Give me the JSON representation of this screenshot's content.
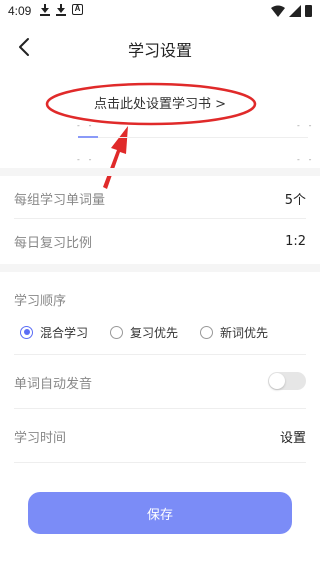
{
  "status_bar": {
    "time": "4:09"
  },
  "header": {
    "title": "学习设置",
    "back_icon": "chevron-left-icon"
  },
  "book": {
    "link_label": "点击此处设置学习书 >",
    "dash_tl": "- -",
    "dash_tr": "- -",
    "dash_bl": "- -",
    "dash_br": "- -"
  },
  "settings": {
    "group_words_label": "每组学习单词量",
    "group_words_value": "5个",
    "review_ratio_label": "每日复习比例",
    "review_ratio_value": "1:2",
    "order_label": "学习顺序",
    "order_options": [
      {
        "label": "混合学习",
        "checked": true
      },
      {
        "label": "复习优先",
        "checked": false
      },
      {
        "label": "新词优先",
        "checked": false
      }
    ],
    "auto_pronounce_label": "单词自动发音",
    "auto_pronounce_on": false,
    "study_time_label": "学习时间",
    "study_time_value": "设置"
  },
  "footer": {
    "save_label": "保存"
  },
  "colors": {
    "accent": "#5b6df5",
    "save_button": "#7b8cf7",
    "annotation_red": "#e02a2a"
  }
}
